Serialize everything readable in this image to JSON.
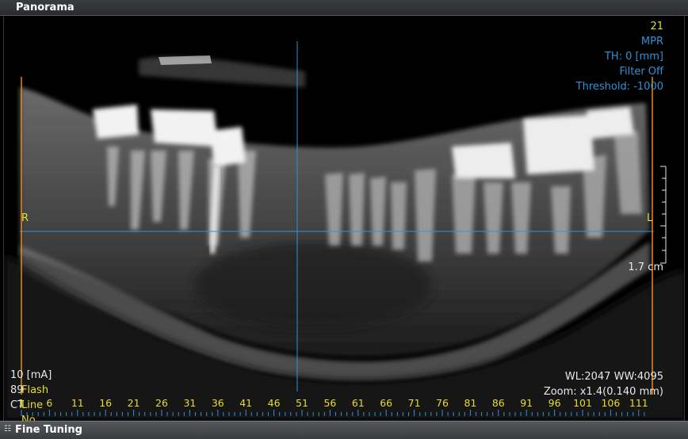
{
  "header": {
    "title": "Panorama"
  },
  "overlay_top_right": {
    "slice": "21",
    "mode": "MPR",
    "thickness": "TH: 0 [mm]",
    "filter": "Filter Off",
    "threshold": "Threshold: -1000"
  },
  "side_markers": {
    "right": "R",
    "left": "L"
  },
  "scale_label": "1.7 cm",
  "overlay_bottom_left": {
    "current": "10 [mA]",
    "kvp": "89",
    "flash_line": "Flash Line No.",
    "ct": "CT"
  },
  "overlay_bottom_right": {
    "window": "WL:2047 WW:4095",
    "zoom": "Zoom: x1.4(0.140 mm)"
  },
  "ruler_numbers": [
    "1",
    "6",
    "11",
    "16",
    "21",
    "26",
    "31",
    "36",
    "41",
    "46",
    "51",
    "56",
    "61",
    "66",
    "71",
    "76",
    "81",
    "86",
    "91",
    "96",
    "101",
    "106",
    "111"
  ],
  "colors": {
    "accent_blue": "#2f93d6",
    "marker_orange": "#e8891a",
    "label_yellow": "#e8dc33"
  },
  "footer": {
    "title": "Fine Tuning",
    "grip_icon": "grip-icon"
  }
}
